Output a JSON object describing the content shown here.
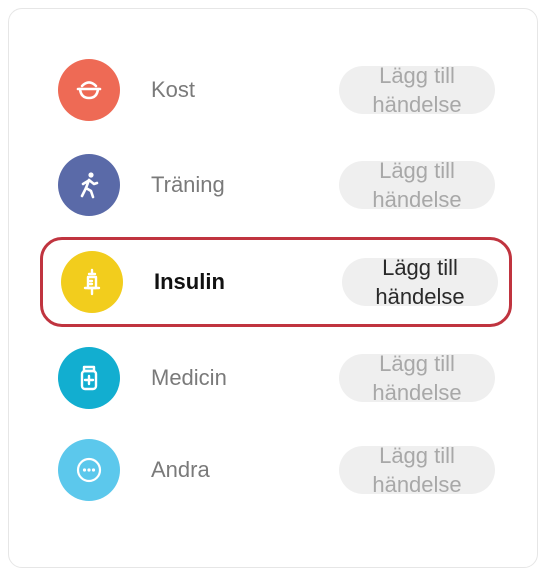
{
  "categories": [
    {
      "id": "kost",
      "label": "Kost",
      "icon": "bowl-icon",
      "color": "#ee6a55",
      "button_label": "Lägg till händelse",
      "highlighted": false
    },
    {
      "id": "traning",
      "label": "Träning",
      "icon": "walking-person-icon",
      "color": "#5a6aa8",
      "button_label": "Lägg till händelse",
      "highlighted": false
    },
    {
      "id": "insulin",
      "label": "Insulin",
      "icon": "syringe-icon",
      "color": "#f2cd1d",
      "button_label": "Lägg till händelse",
      "highlighted": true
    },
    {
      "id": "medicin",
      "label": "Medicin",
      "icon": "medicine-bottle-icon",
      "color": "#12aed0",
      "button_label": "Lägg till händelse",
      "highlighted": false
    },
    {
      "id": "andra",
      "label": "Andra",
      "icon": "more-dots-icon",
      "color": "#5cc8ec",
      "button_label": "Lägg till händelse",
      "highlighted": false
    }
  ],
  "highlight_color": "#c0343f"
}
